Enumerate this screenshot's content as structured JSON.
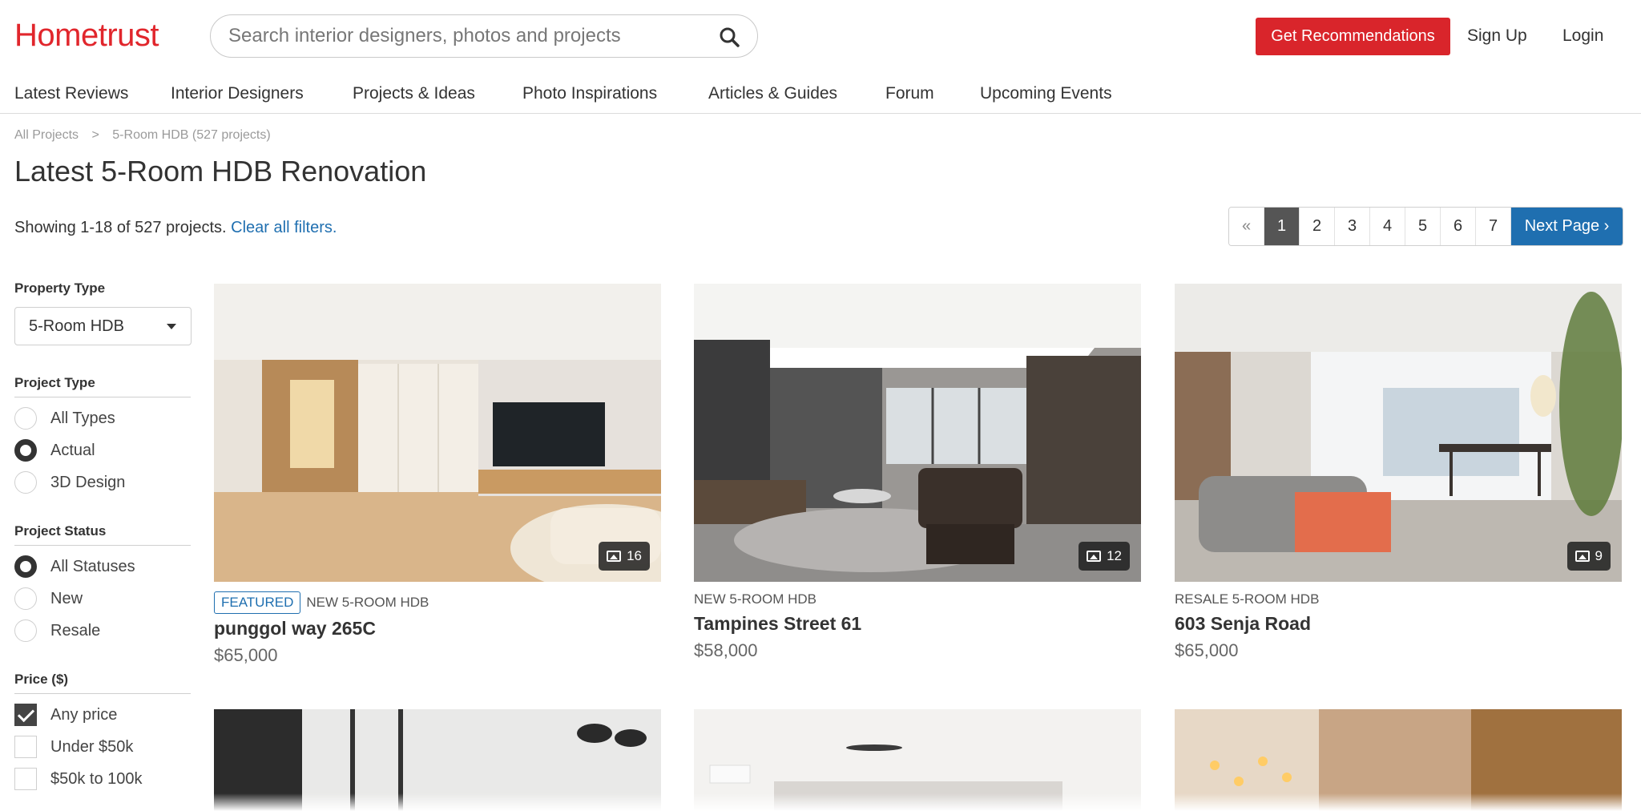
{
  "brand": {
    "logo_text": "Hometrust",
    "accent_color": "#d9252b",
    "link_color": "#1f6fb0"
  },
  "search": {
    "placeholder": "Search interior designers, photos and projects",
    "icon": "search-icon"
  },
  "header": {
    "recommend_label": "Get Recommendations",
    "signup_label": "Sign Up",
    "login_label": "Login"
  },
  "nav": {
    "items": [
      {
        "label": "Latest Reviews"
      },
      {
        "label": "Interior Designers"
      },
      {
        "label": "Projects & Ideas"
      },
      {
        "label": "Photo Inspirations"
      },
      {
        "label": "Articles & Guides"
      },
      {
        "label": "Forum"
      },
      {
        "label": "Upcoming Events"
      }
    ]
  },
  "breadcrumb": {
    "items": [
      "All Projects",
      "5-Room HDB (527 projects)"
    ],
    "separator": ">"
  },
  "page": {
    "title": "Latest 5-Room HDB Renovation"
  },
  "results": {
    "showing_text": "Showing 1-18 of 527 projects.",
    "clear_label": "Clear all filters."
  },
  "pagination": {
    "prev_symbol": "«",
    "pages": [
      "1",
      "2",
      "3",
      "4",
      "5",
      "6",
      "7"
    ],
    "current": "1",
    "next_label": "Next Page ›"
  },
  "filters": {
    "property_type": {
      "title": "Property Type",
      "selected": "5-Room HDB"
    },
    "project_type": {
      "title": "Project Type",
      "options": [
        {
          "label": "All Types",
          "checked": false
        },
        {
          "label": "Actual",
          "checked": true
        },
        {
          "label": "3D Design",
          "checked": false
        }
      ]
    },
    "project_status": {
      "title": "Project Status",
      "options": [
        {
          "label": "All Statuses",
          "checked": true
        },
        {
          "label": "New",
          "checked": false
        },
        {
          "label": "Resale",
          "checked": false
        }
      ]
    },
    "price": {
      "title": "Price ($)",
      "options": [
        {
          "label": "Any price",
          "checked": true
        },
        {
          "label": "Under $50k",
          "checked": false
        },
        {
          "label": "$50k to 100k",
          "checked": false
        }
      ]
    }
  },
  "cards": [
    {
      "featured_label": "FEATURED",
      "category": "NEW 5-ROOM HDB",
      "title": "punggol way 265C",
      "price": "$65,000",
      "photo_count": "16"
    },
    {
      "category": "NEW 5-ROOM HDB",
      "title": "Tampines Street 61",
      "price": "$58,000",
      "photo_count": "12"
    },
    {
      "category": "RESALE 5-ROOM HDB",
      "title": "603 Senja Road",
      "price": "$65,000",
      "photo_count": "9"
    }
  ]
}
